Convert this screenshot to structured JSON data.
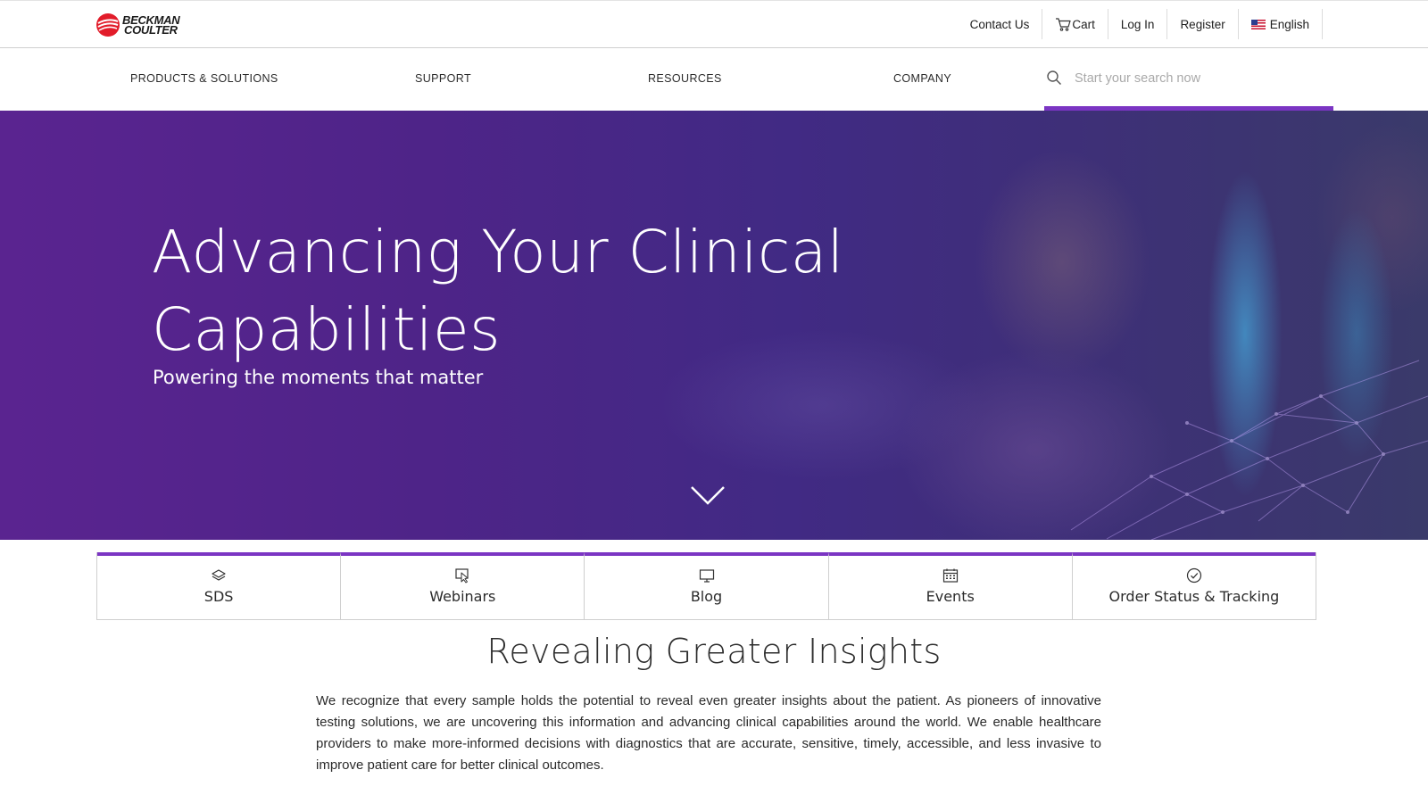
{
  "brand": {
    "logo_line1": "BECKMAN",
    "logo_line2": "COULTER",
    "accent_color": "#7b35c3",
    "logo_color": "#e21c2a"
  },
  "utility_nav": {
    "contact": "Contact Us",
    "cart": "Cart",
    "login": "Log In",
    "register": "Register",
    "language": "English"
  },
  "main_nav": {
    "items": [
      "PRODUCTS & SOLUTIONS",
      "SUPPORT",
      "RESOURCES",
      "COMPANY"
    ],
    "search_placeholder": "Start your search now"
  },
  "hero": {
    "title": "Advancing Your Clinical Capabilities",
    "subtitle": "Powering the moments that matter"
  },
  "quick_links": [
    {
      "label": "SDS",
      "icon": "layers-icon"
    },
    {
      "label": "Webinars",
      "icon": "webinar-cursor-icon"
    },
    {
      "label": "Blog",
      "icon": "monitor-icon"
    },
    {
      "label": "Events",
      "icon": "calendar-icon"
    },
    {
      "label": "Order Status & Tracking",
      "icon": "check-circle-icon"
    }
  ],
  "insights": {
    "title": "Revealing Greater Insights",
    "body": "We recognize that every sample holds the potential to reveal even greater insights about the patient. As pioneers of innovative testing solutions, we are uncovering this information and advancing clinical capabilities around the world. We enable healthcare providers to make more-informed decisions with diagnostics that are accurate, sensitive, timely, accessible, and less invasive to improve patient care for better clinical outcomes."
  }
}
